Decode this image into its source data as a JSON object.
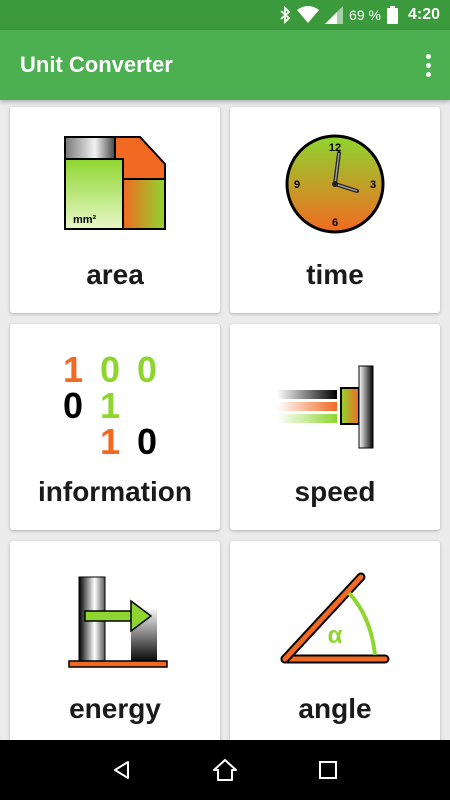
{
  "status_bar": {
    "battery_text": "69 %",
    "time": "4:20",
    "icons": [
      "bluetooth-icon",
      "wifi-icon",
      "signal-icon",
      "battery-icon"
    ]
  },
  "app_bar": {
    "title": "Unit Converter",
    "menu_icon": "more-vert-icon"
  },
  "categories": [
    {
      "label": "area",
      "icon": "area-icon"
    },
    {
      "label": "time",
      "icon": "clock-icon"
    },
    {
      "label": "information",
      "icon": "binary-icon"
    },
    {
      "label": "speed",
      "icon": "speed-icon"
    },
    {
      "label": "energy",
      "icon": "energy-icon"
    },
    {
      "label": "angle",
      "icon": "angle-icon"
    }
  ],
  "area_icon_unit": "mm²",
  "clock_icon_numbers": [
    "12",
    "3",
    "6",
    "9"
  ],
  "binary_icon_digits": [
    "1",
    "0",
    "0",
    "0",
    "1",
    "1",
    "0"
  ],
  "angle_icon_symbol": "α",
  "nav_bar": {
    "icons": [
      "back-icon",
      "home-icon",
      "recents-icon"
    ]
  },
  "colors": {
    "status_bar": "#3a9a3c",
    "app_bar": "#4caf50",
    "accent_orange": "#f26a21",
    "accent_green": "#8ed62f"
  }
}
